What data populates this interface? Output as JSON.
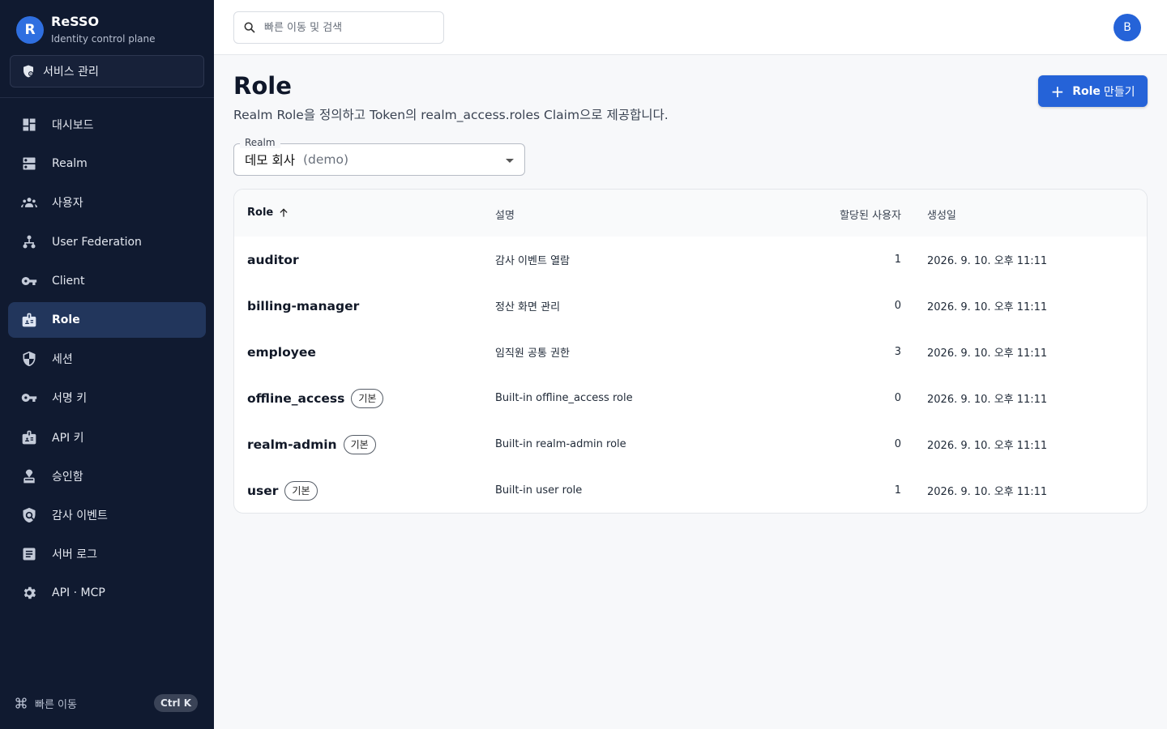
{
  "app": {
    "logo_letter": "R",
    "name": "ReSSO",
    "subtitle": "Identity control plane"
  },
  "sidebar": {
    "service_button": "서비스 관리",
    "items": [
      {
        "label": "대시보드",
        "icon": "dashboard-icon"
      },
      {
        "label": "Realm",
        "icon": "dns-icon"
      },
      {
        "label": "사용자",
        "icon": "group-icon"
      },
      {
        "label": "User Federation",
        "icon": "hierarchy-icon"
      },
      {
        "label": "Client",
        "icon": "key-icon"
      },
      {
        "label": "Role",
        "icon": "badge-icon",
        "active": true
      },
      {
        "label": "세션",
        "icon": "shield-icon"
      },
      {
        "label": "서명 키",
        "icon": "key-icon"
      },
      {
        "label": "API 키",
        "icon": "badge-icon"
      },
      {
        "label": "승인함",
        "icon": "approval-icon"
      },
      {
        "label": "감사 이벤트",
        "icon": "policy-icon"
      },
      {
        "label": "서버 로그",
        "icon": "article-icon"
      },
      {
        "label": "API · MCP",
        "icon": "gear-icon"
      }
    ],
    "quick_nav": {
      "label": "빠른 이동",
      "shortcut": "Ctrl K"
    }
  },
  "topbar": {
    "search_placeholder": "빠른 이동 및 검색",
    "avatar_letter": "B"
  },
  "page": {
    "title": "Role",
    "description": "Realm Role을 정의하고 Token의 realm_access.roles Claim으로 제공합니다.",
    "create_button_bold": "Role",
    "create_button_rest": "만들기"
  },
  "realm_select": {
    "label": "Realm",
    "value_name": "데모 회사",
    "value_slug": "(demo)"
  },
  "table": {
    "columns": {
      "role": "Role",
      "description": "설명",
      "assigned": "할당된 사용자",
      "created": "생성일"
    },
    "rows": [
      {
        "name": "auditor",
        "badge": "",
        "description": "감사 이벤트 열람",
        "assigned": "1",
        "created": "2026. 9. 10. 오후 11:11"
      },
      {
        "name": "billing-manager",
        "badge": "",
        "description": "정산 화면 관리",
        "assigned": "0",
        "created": "2026. 9. 10. 오후 11:11"
      },
      {
        "name": "employee",
        "badge": "",
        "description": "임직원 공통 권한",
        "assigned": "3",
        "created": "2026. 9. 10. 오후 11:11"
      },
      {
        "name": "offline_access",
        "badge": "기본",
        "description": "Built-in offline_access role",
        "assigned": "0",
        "created": "2026. 9. 10. 오후 11:11"
      },
      {
        "name": "realm-admin",
        "badge": "기본",
        "description": "Built-in realm-admin role",
        "assigned": "0",
        "created": "2026. 9. 10. 오후 11:11"
      },
      {
        "name": "user",
        "badge": "기본",
        "description": "Built-in user role",
        "assigned": "1",
        "created": "2026. 9. 10. 오후 11:11"
      }
    ]
  }
}
